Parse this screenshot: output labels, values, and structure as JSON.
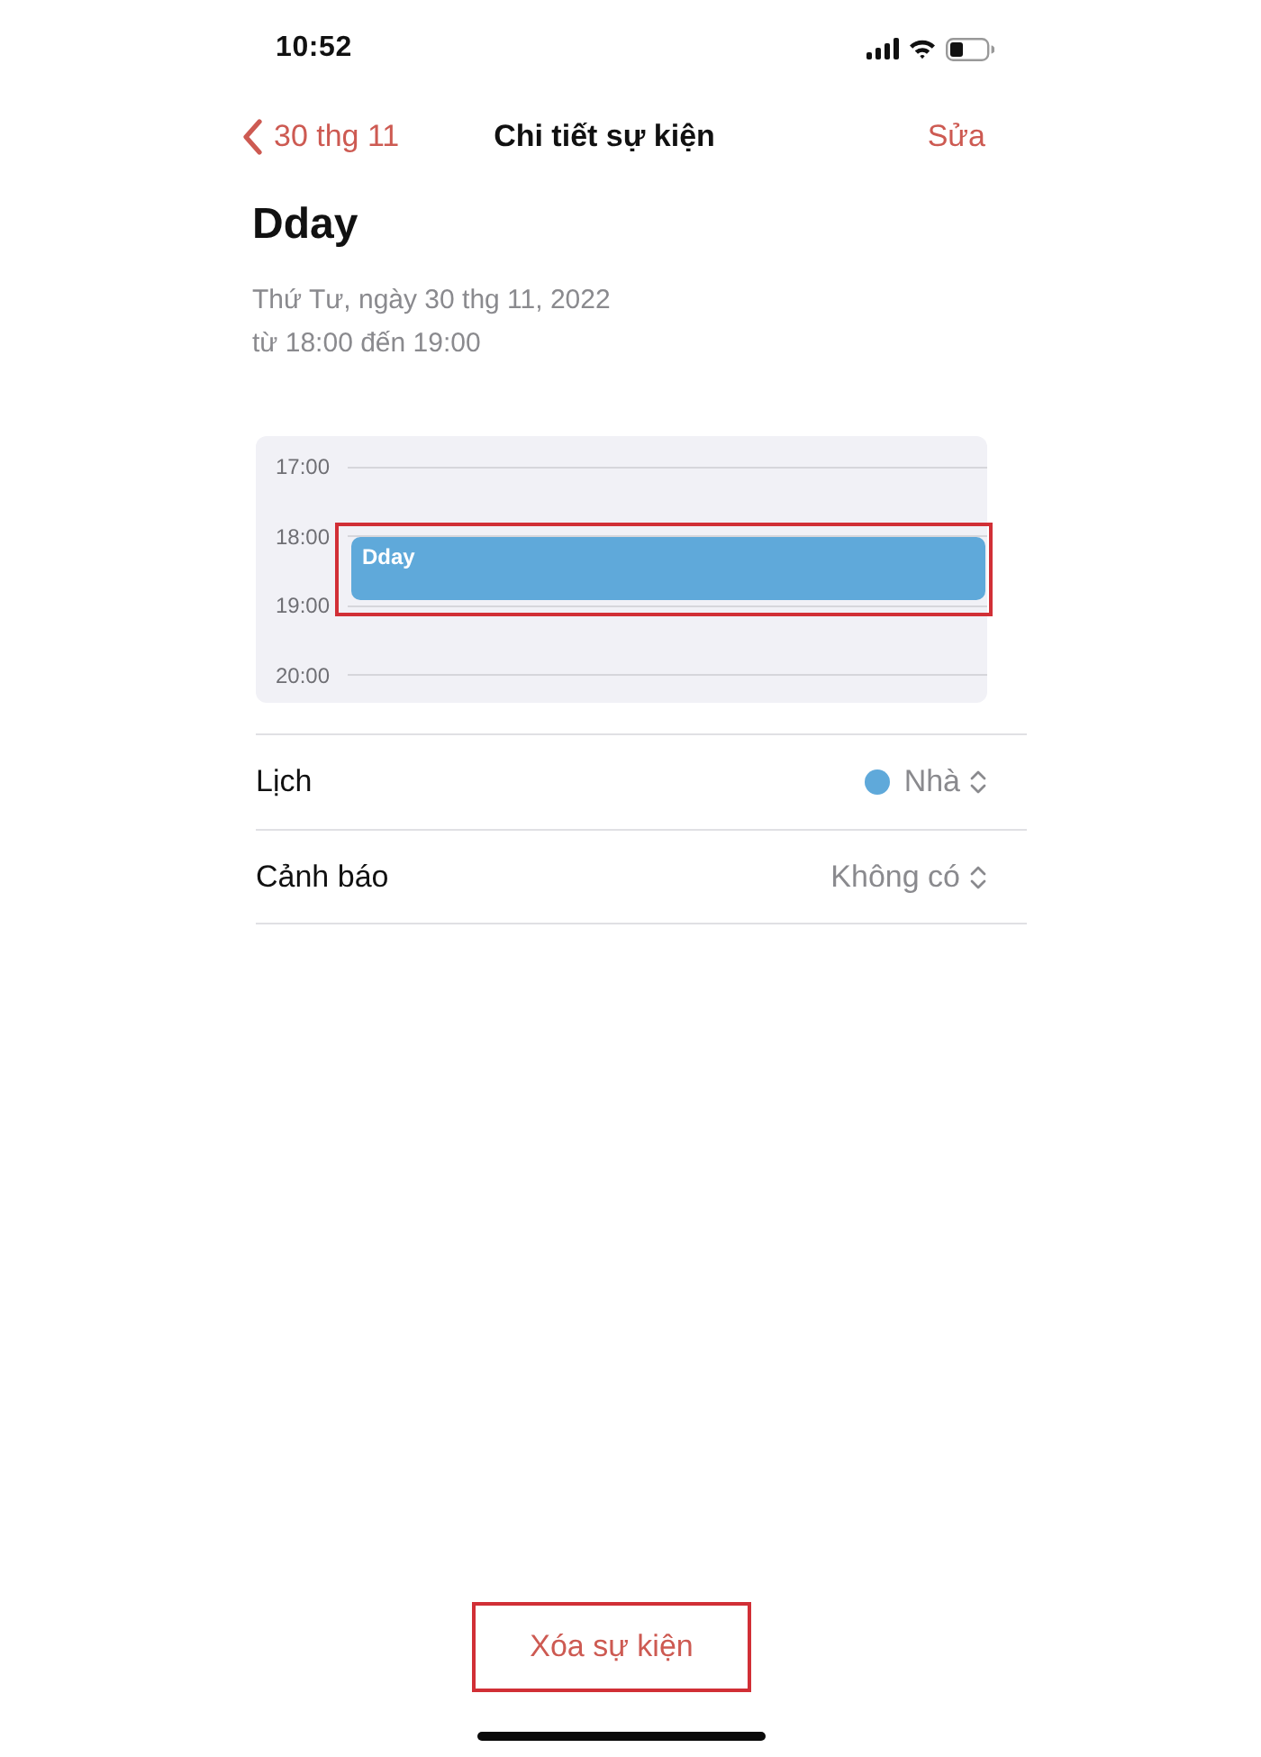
{
  "status_bar": {
    "time": "10:52"
  },
  "nav": {
    "back": "30 thg 11",
    "title": "Chi tiết sự kiện",
    "action": "Sửa"
  },
  "event": {
    "title": "Dday",
    "date": "Thứ Tư, ngày 30 thg 11, 2022",
    "time_range": "từ 18:00 đến 19:00"
  },
  "timeline": {
    "hours": [
      "17:00",
      "18:00",
      "19:00",
      "20:00"
    ],
    "event_block": {
      "label": "Dday",
      "highlighted": true
    }
  },
  "rows": [
    {
      "kind": "calendar",
      "label": "Lịch",
      "value": "Nhà",
      "color": "#5fa9da"
    },
    {
      "kind": "plain",
      "label": "Cảnh báo",
      "value": "Không có"
    }
  ],
  "delete_button": {
    "label": "Xóa sự kiện",
    "highlighted": true
  }
}
